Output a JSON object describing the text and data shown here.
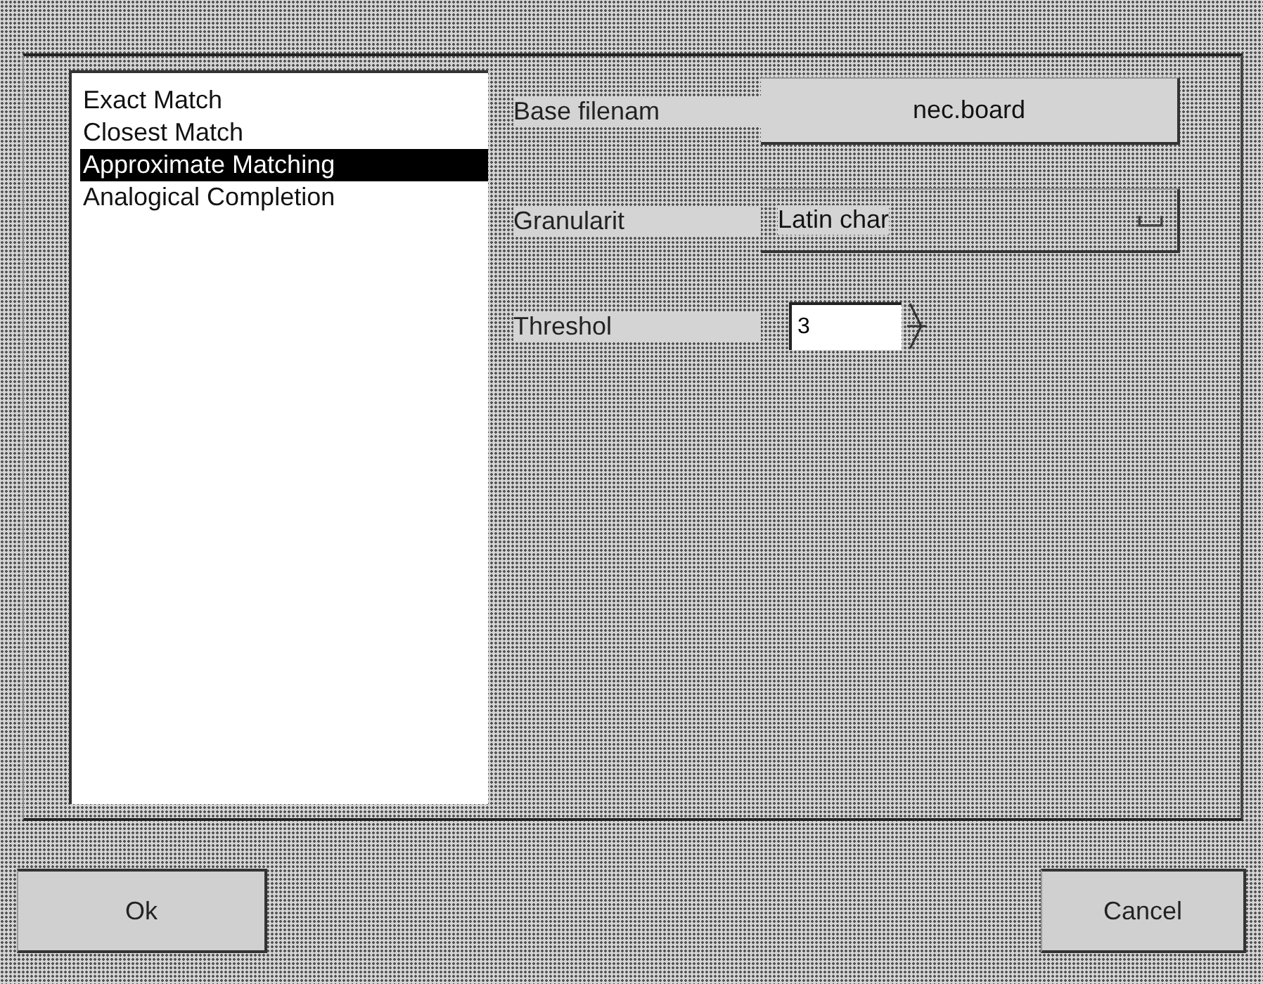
{
  "match_modes": [
    {
      "label": "Exact Match",
      "selected": false
    },
    {
      "label": "Closest Match",
      "selected": false
    },
    {
      "label": "Approximate Matching",
      "selected": true
    },
    {
      "label": "Analogical Completion",
      "selected": false
    }
  ],
  "fields": [
    {
      "kind": "button",
      "label": "Base filenam",
      "value": "nec.board"
    },
    {
      "kind": "dropdown",
      "label": "Granularit",
      "value": "Latin char"
    },
    {
      "kind": "spinner",
      "label": "Threshol",
      "value": "3"
    }
  ],
  "buttons": [
    {
      "kind": "ok",
      "label": "Ok"
    },
    {
      "kind": "cancel",
      "label": "Cancel"
    }
  ]
}
